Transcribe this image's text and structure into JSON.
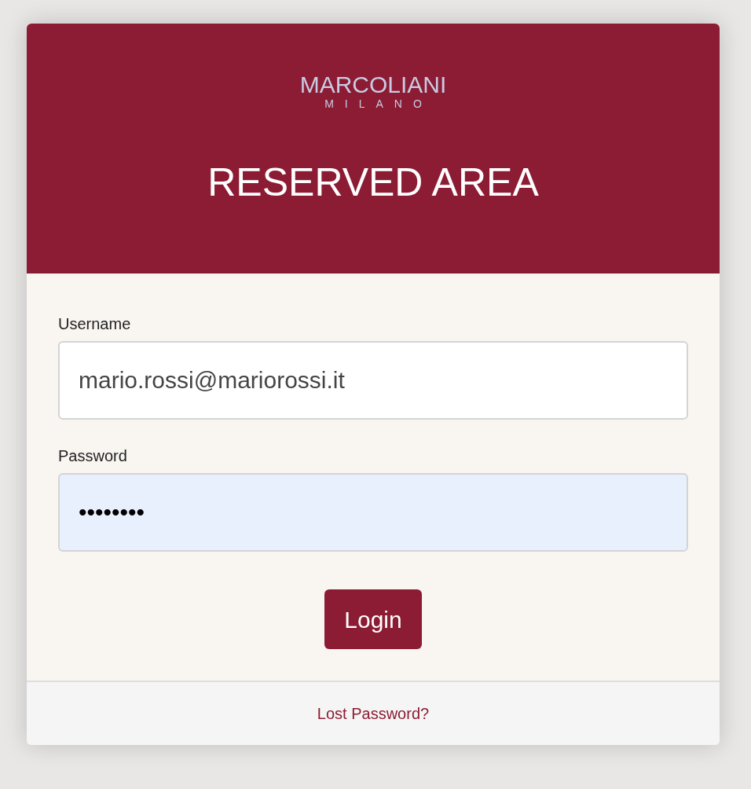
{
  "logo": {
    "name": "MARCOLIANI",
    "subtitle": "MILANO"
  },
  "title": "RESERVED AREA",
  "fields": [
    {
      "label": "Username",
      "value": "mario.rossi@mariorossi.it",
      "autofilled": false
    },
    {
      "label": "Password",
      "value": "••••••••",
      "autofilled": true
    }
  ],
  "login_button": "Login",
  "footer_link": "Lost Password?"
}
